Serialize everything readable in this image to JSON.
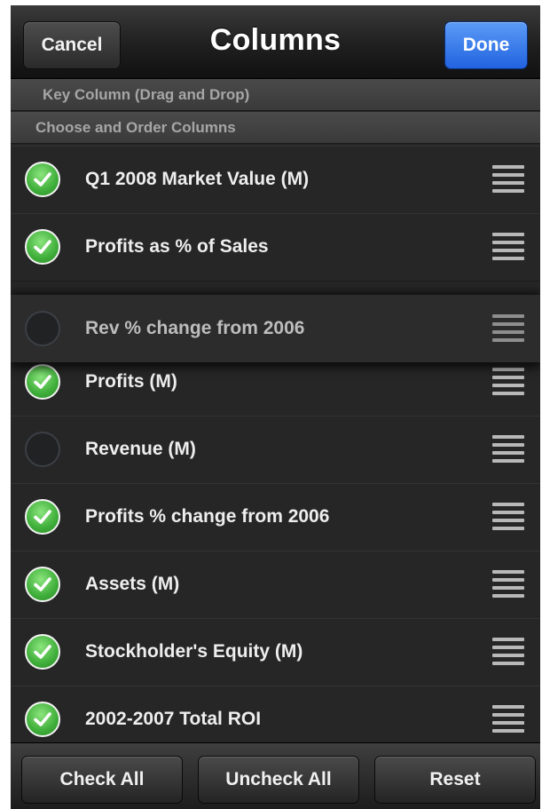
{
  "navbar": {
    "title": "Columns",
    "cancel_label": "Cancel",
    "done_label": "Done"
  },
  "sections": {
    "key_column": "Key Column (Drag and Drop)",
    "choose_order": "Choose and Order Columns"
  },
  "columns": [
    {
      "label": "Q1 2008 Market Value (M)",
      "checked": true
    },
    {
      "label": "Profits as % of Sales",
      "checked": true
    },
    {
      "label": "Rev % change from 2006",
      "checked": false,
      "dragging": true
    },
    {
      "label": "Profits (M)",
      "checked": true
    },
    {
      "label": "Revenue (M)",
      "checked": false
    },
    {
      "label": "Profits % change from 2006",
      "checked": true
    },
    {
      "label": "Assets (M)",
      "checked": true
    },
    {
      "label": "Stockholder's Equity (M)",
      "checked": true
    },
    {
      "label": "2002-2007 Total ROI",
      "checked": true
    }
  ],
  "toolbar": {
    "check_all_label": "Check All",
    "uncheck_all_label": "Uncheck All",
    "reset_label": "Reset"
  },
  "icons": {
    "checked": "checkmark-circle-icon",
    "unchecked": "empty-circle-icon",
    "reorder": "reorder-grip-icon"
  },
  "colors": {
    "done_button": "#2d6fe8",
    "check_green": "#3fae3a",
    "background": "#262626"
  }
}
